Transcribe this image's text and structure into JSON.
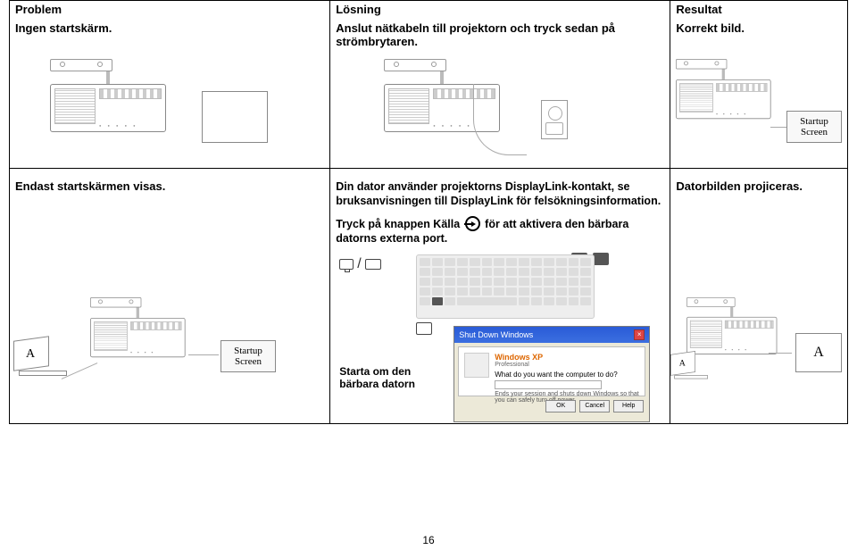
{
  "headers": {
    "problem": "Problem",
    "solution": "Lösning",
    "result": "Resultat"
  },
  "row1": {
    "problem": "Ingen startskärm.",
    "solution": "Anslut nätkabeln till projektorn och tryck sedan på strömbrytaren.",
    "result": "Korrekt bild."
  },
  "startup_label": "Startup Screen",
  "row2": {
    "problem": "Endast startskärmen visas.",
    "solution_line1": "Din dator använder projektorns DisplayLink-kontakt, se bruksanvisningen till DisplayLink för felsökningsinformation.",
    "solution_line2a": "Tryck på knappen Källa",
    "solution_line2b": "för att aktivera den bärbara datorns externa port.",
    "result": "Datorbilden projiceras."
  },
  "restart_caption": "Starta om den bärbara datorn",
  "dialog": {
    "title": "Shut Down Windows",
    "brand": "Windows XP",
    "edition": "Professional",
    "question": "What do you want the computer to do?",
    "desc": "Ends your session and shuts down Windows so that you can safely turn off power.",
    "ok": "OK",
    "cancel": "Cancel",
    "help": "Help"
  },
  "laptop_letter": "A",
  "page": "16"
}
